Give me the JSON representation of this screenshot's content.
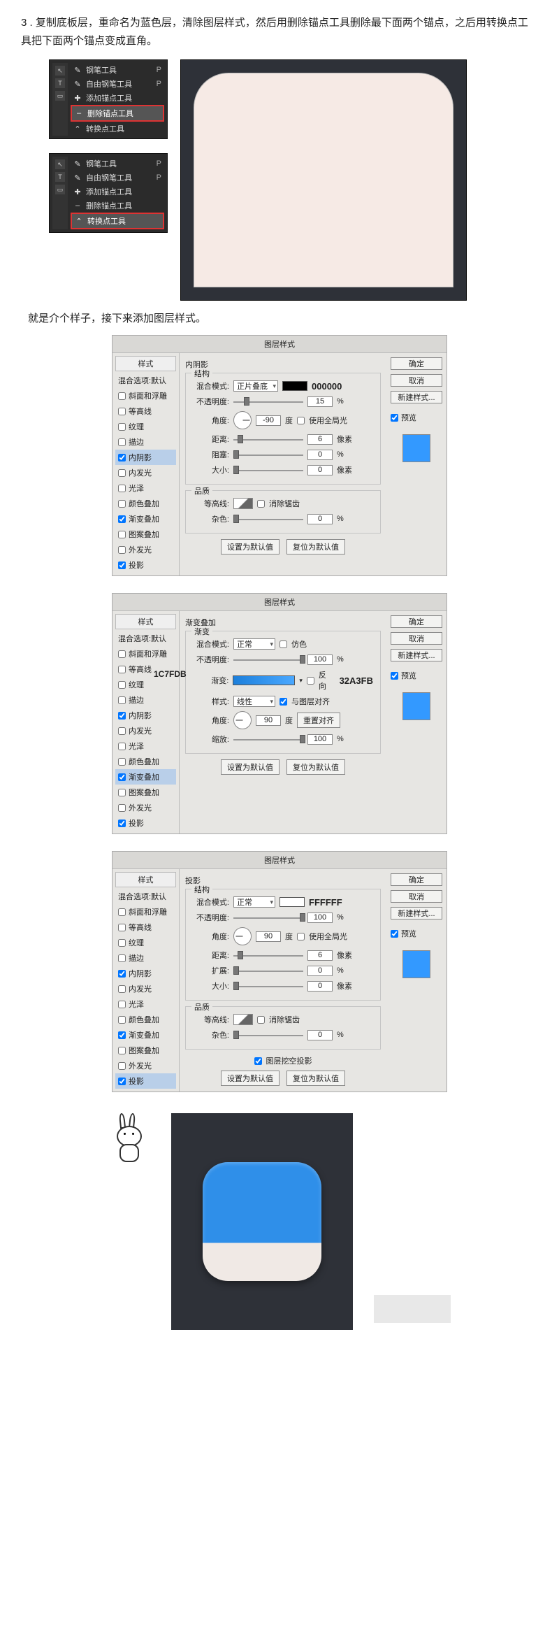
{
  "intro": "3 . 复制底板层，重命名为蓝色层，清除图层样式，然后用删除锚点工具删除最下面两个锚点，之后用转换点工具把下面两个锚点变成直角。",
  "tool_menu": {
    "shortcutP": "P",
    "items": [
      "钢笔工具",
      "自由钢笔工具",
      "添加锚点工具",
      "删除锚点工具",
      "转换点工具"
    ],
    "highlight1": "删除锚点工具",
    "highlight2": "转换点工具"
  },
  "side_icons": [
    "↖",
    "T",
    "▭"
  ],
  "mid_text": "就是介个样子，接下来添加图层样式。",
  "dialog_title": "图层样式",
  "styles_header": "样式",
  "blend_options": "混合选项:默认",
  "style_options": [
    "斜面和浮雕",
    "等高线",
    "纹理",
    "描边",
    "内阴影",
    "内发光",
    "光泽",
    "颜色叠加",
    "渐变叠加",
    "图案叠加",
    "外发光",
    "投影"
  ],
  "checked_indices": [
    4,
    8,
    11
  ],
  "btns": {
    "ok": "确定",
    "cancel": "取消",
    "new": "新建样式...",
    "preview": "预览"
  },
  "common": {
    "set_default": "设置为默认值",
    "reset_default": "复位为默认值"
  },
  "d1": {
    "title": "内阴影",
    "struct": "结构",
    "mode_label": "混合模式:",
    "mode": "正片叠底",
    "color_code": "000000",
    "opacity_label": "不透明度:",
    "opacity": "15",
    "pct": "%",
    "angle_label": "角度:",
    "angle": "-90",
    "deg": "度",
    "global": "使用全局光",
    "dist_label": "距离:",
    "dist": "6",
    "px": "像素",
    "choke_label": "阻塞:",
    "choke": "0",
    "size_label": "大小:",
    "size": "0",
    "quality": "品质",
    "contour_label": "等高线:",
    "anti": "消除锯齿",
    "noise_label": "杂色:",
    "noise": "0"
  },
  "d2": {
    "title": "渐变叠加",
    "grad": "渐变",
    "mode_label": "混合模式:",
    "mode": "正常",
    "dither": "仿色",
    "opacity_label": "不透明度:",
    "opacity": "100",
    "pct": "%",
    "grad_label": "渐变:",
    "reverse": "反向",
    "code_left": "1C7FDB",
    "code_right": "32A3FB",
    "style_label": "样式:",
    "style": "线性",
    "align": "与图层对齐",
    "angle_label": "角度:",
    "angle": "90",
    "deg": "度",
    "reset_align": "重置对齐",
    "scale_label": "缩放:",
    "scale": "100"
  },
  "d3": {
    "title": "投影",
    "struct": "结构",
    "mode_label": "混合模式:",
    "mode": "正常",
    "color_code": "FFFFFF",
    "opacity_label": "不透明度:",
    "opacity": "100",
    "pct": "%",
    "angle_label": "角度:",
    "angle": "90",
    "deg": "度",
    "global": "使用全局光",
    "dist_label": "距离:",
    "dist": "6",
    "px": "像素",
    "spread_label": "扩展:",
    "spread": "0",
    "size_label": "大小:",
    "size": "0",
    "quality": "品质",
    "contour_label": "等高线:",
    "anti": "消除锯齿",
    "noise_label": "杂色:",
    "noise": "0",
    "knockout": "图层挖空投影"
  }
}
